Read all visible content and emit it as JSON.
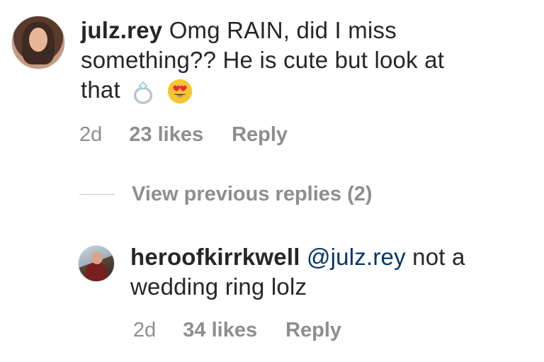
{
  "comments": {
    "top": {
      "username": "julz.rey",
      "text_line1": "Omg RAIN, did I miss",
      "text_line2": "something?? He is cute but look at",
      "text_line3": "that",
      "emoji1": "ring-icon",
      "emoji2": "heart-eyes-icon",
      "time": "2d",
      "likes": "23 likes",
      "reply_label": "Reply"
    },
    "view_previous": "View previous replies (2)",
    "reply": {
      "username": "heroofkirrkwell",
      "mention": "@julz.rey",
      "text_line1": "not a",
      "text_line2": "wedding ring lolz",
      "time": "2d",
      "likes": "34 likes",
      "reply_label": "Reply"
    }
  },
  "colors": {
    "text": "#262626",
    "meta": "#8e8e8e",
    "mention": "#003569"
  }
}
